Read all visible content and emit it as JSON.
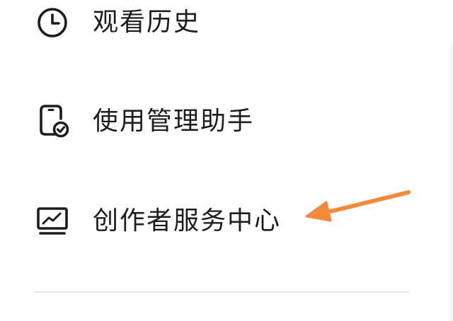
{
  "menu": {
    "items": [
      {
        "label": "观看历史",
        "icon": "clock-icon"
      },
      {
        "label": "使用管理助手",
        "icon": "phone-check-icon"
      },
      {
        "label": "创作者服务中心",
        "icon": "monitor-chart-icon"
      }
    ]
  },
  "annotation": {
    "arrow_color": "#F28A3A",
    "icon": "arrow-left-annotation"
  },
  "colors": {
    "text": "#1C1C1C",
    "divider": "#E6E6E6",
    "background": "#FFFFFF"
  }
}
